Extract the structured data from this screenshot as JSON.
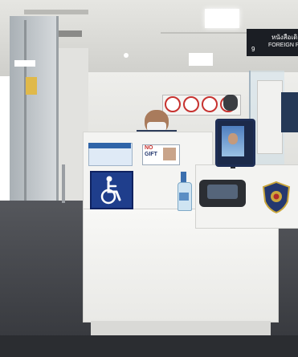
{
  "photo": {
    "subject": "Immigration passport control counter"
  },
  "signs": {
    "overhead_thai": "หนังสือเดิ",
    "overhead_english": "FOREIGN P",
    "overhead_number": "9",
    "no_gift_line1": "NO",
    "no_gift_line2": "GIFT"
  },
  "icons": {
    "accessibility": "wheelchair-icon",
    "police_badge": "police-shield-icon",
    "prohibition_signs": [
      "no-camera-icon",
      "no-phone-icon",
      "no-food-icon",
      "no-smoking-icon"
    ]
  },
  "colors": {
    "ceiling": "#dcdcd8",
    "wall": "#e9e9e6",
    "counter": "#f6f6f4",
    "floor": "#3f4147",
    "accessibility_blue": "#1f3e8c",
    "overhead_sign": "#1b1e24",
    "prohibition_red": "#c7322f",
    "badge_blue": "#24386f"
  }
}
